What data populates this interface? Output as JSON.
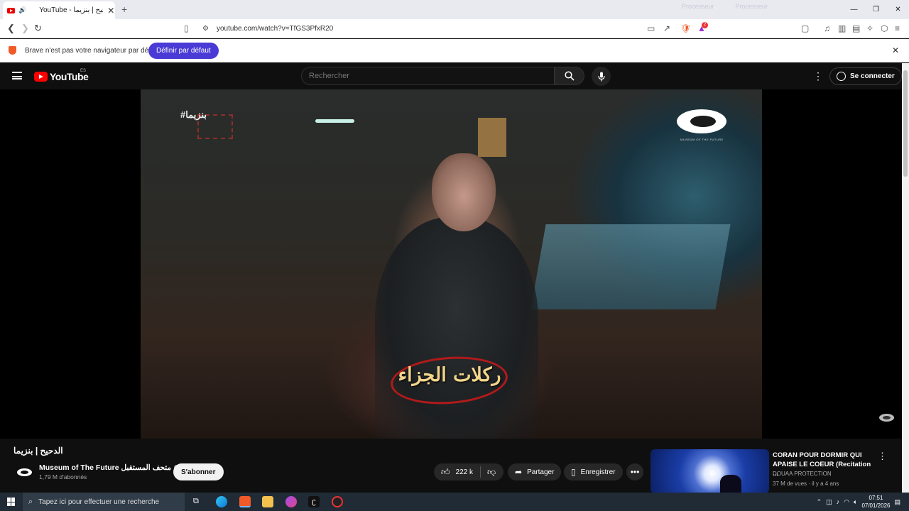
{
  "browser": {
    "tab_title": "YouTube - الدحيح | بنزيما",
    "tab_close": "✕",
    "new_tab": "+",
    "sysmon": [
      "Processeur",
      "Processeur"
    ],
    "url": "youtube.com/watch?v=TfGS3PfxR20",
    "brave_badge": "2",
    "win_controls": [
      "—",
      "❐",
      "✕"
    ]
  },
  "infobar": {
    "message": "Brave n'est pas votre navigateur par défaut",
    "button": "Définir par défaut",
    "close": "✕"
  },
  "youtube": {
    "logo_word": "YouTube",
    "country_code": "ES",
    "search_placeholder": "Rechercher",
    "more": "⋮",
    "signin_label": "Se connecter"
  },
  "video": {
    "hashtag": "#بنزيما",
    "brand_sub": "MUSEUM OF THE FUTURE",
    "caption": "ركلات الجزاء",
    "title": "الدحيح | بنزيما"
  },
  "channel": {
    "name": "Museum of The Future متحف المستقبل",
    "subscribers": "1,79 M d'abonnés",
    "subscribe_label": "S'abonner"
  },
  "actions": {
    "likes": "222 k",
    "share": "Partager",
    "save": "Enregistrer",
    "more": "•••"
  },
  "recommendation": {
    "title": "CORAN POUR DORMIR QUI APAISE LE COEUR (Recitation ...",
    "channel": "DOUAA PROTECTION",
    "meta": "37 M de vues · il y a 4 ans"
  },
  "taskbar": {
    "search_placeholder": "Tapez ici pour effectuer une recherche",
    "time": "07:51",
    "date": "07/01/2026"
  },
  "colors": {
    "yt_red": "#ff0000",
    "brave_purple": "#4a3bd6",
    "yt_bg": "#0f0f0f"
  }
}
